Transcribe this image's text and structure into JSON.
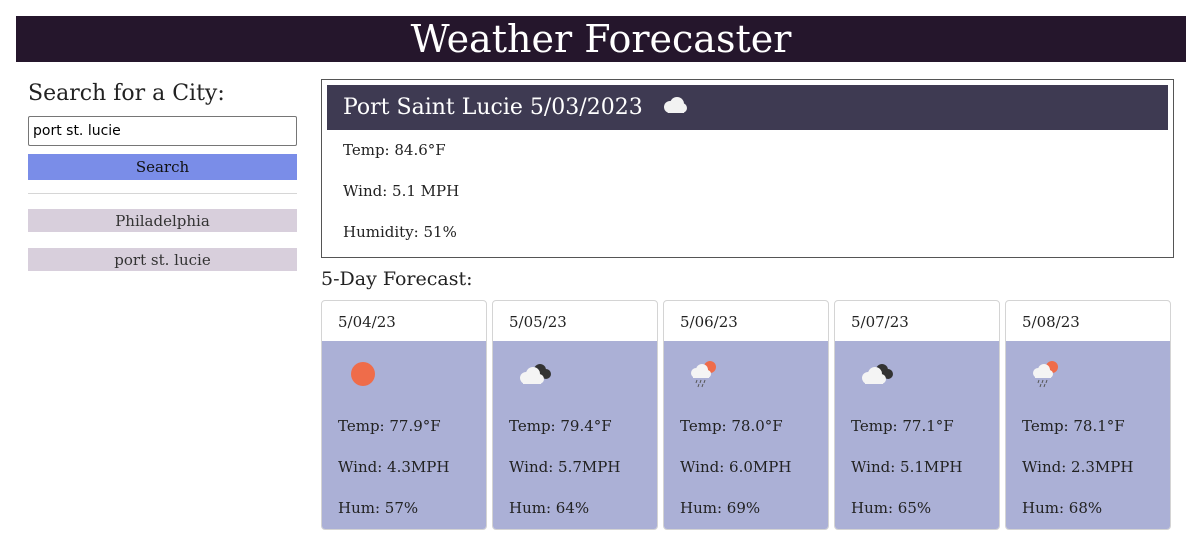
{
  "header": {
    "title": "Weather Forecaster"
  },
  "sidebar": {
    "search_title": "Search for a City:",
    "search_value": "port st. lucie",
    "search_button": "Search",
    "history": [
      "Philadelphia",
      "port st. lucie"
    ]
  },
  "current": {
    "city_date": "Port Saint Lucie 5/03/2023",
    "icon": "cloud-icon",
    "temp": "Temp: 84.6°F",
    "wind": "Wind: 5.1 MPH",
    "humidity": "Humidity: 51%"
  },
  "forecast": {
    "title": "5-Day Forecast:",
    "days": [
      {
        "date": "5/04/23",
        "icon": "sun-icon",
        "temp": "Temp: 77.9°F",
        "wind": "Wind: 4.3MPH",
        "hum": "Hum: 57%"
      },
      {
        "date": "5/05/23",
        "icon": "broken-clouds-icon",
        "temp": "Temp: 79.4°F",
        "wind": "Wind: 5.7MPH",
        "hum": "Hum: 64%"
      },
      {
        "date": "5/06/23",
        "icon": "rain-icon",
        "temp": "Temp: 78.0°F",
        "wind": "Wind: 6.0MPH",
        "hum": "Hum: 69%"
      },
      {
        "date": "5/07/23",
        "icon": "broken-clouds-icon",
        "temp": "Temp: 77.1°F",
        "wind": "Wind: 5.1MPH",
        "hum": "Hum: 65%"
      },
      {
        "date": "5/08/23",
        "icon": "rain-icon",
        "temp": "Temp: 78.1°F",
        "wind": "Wind: 2.3MPH",
        "hum": "Hum: 68%"
      }
    ]
  },
  "colors": {
    "header_bg": "#25162c",
    "current_header_bg": "#3e3a52",
    "search_button": "#7a8de8",
    "history_button": "#d8cfdc",
    "card_body": "#abb0d6",
    "sun": "#ef6c4a"
  }
}
